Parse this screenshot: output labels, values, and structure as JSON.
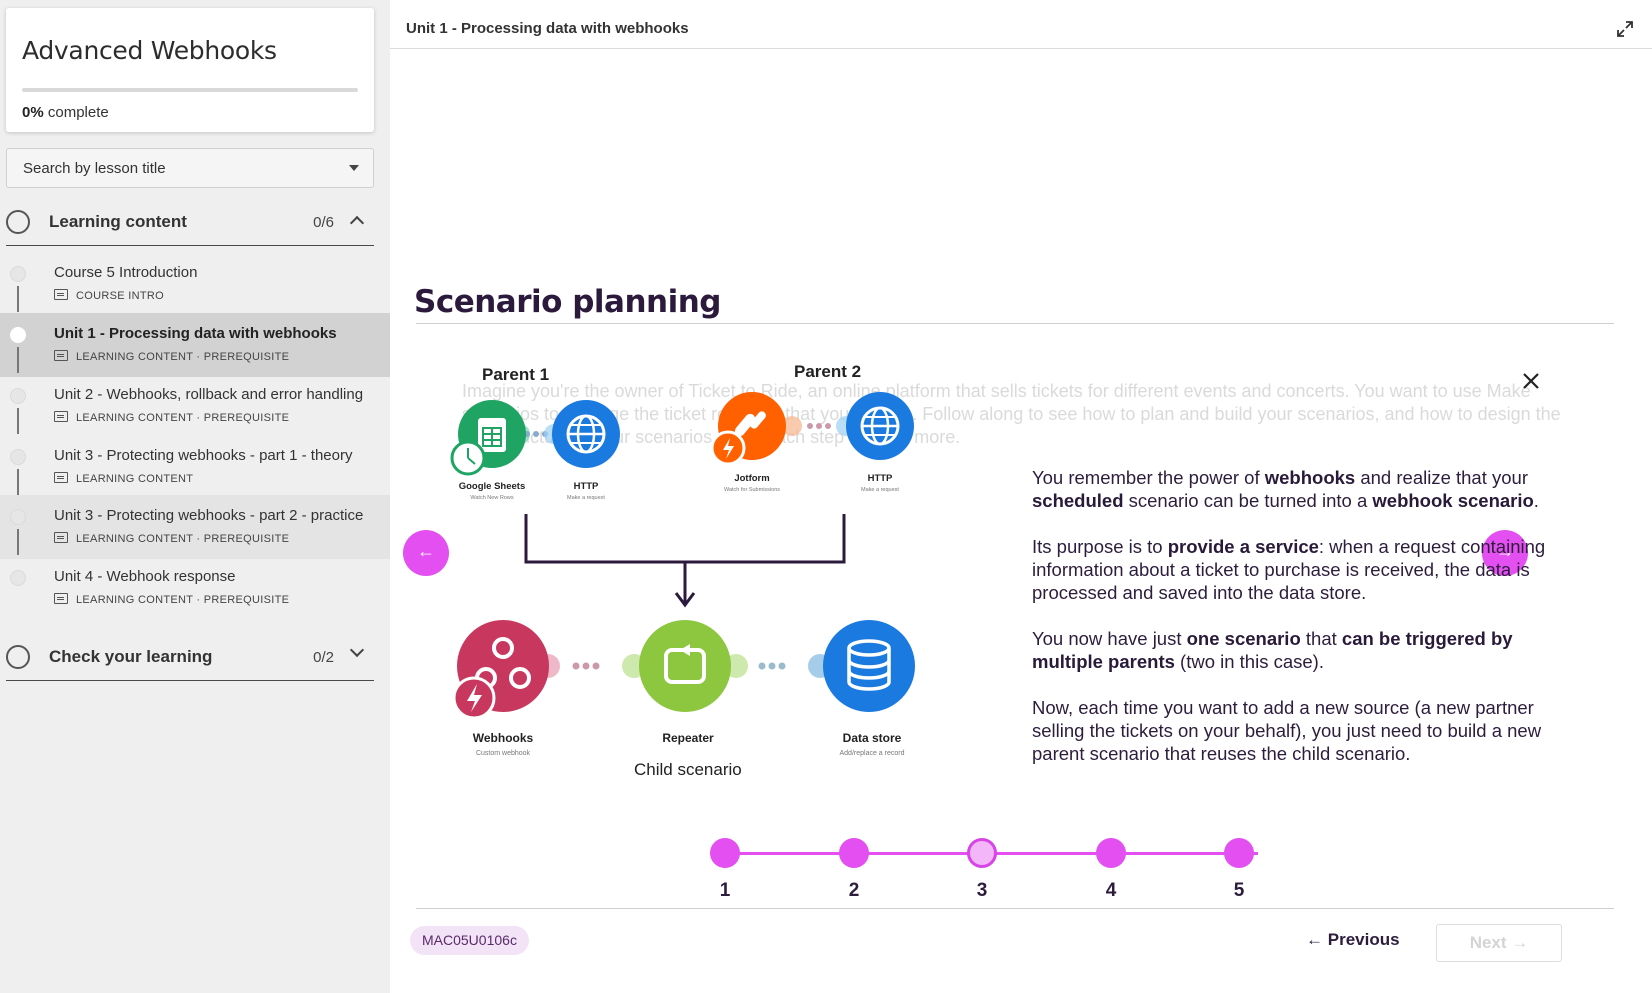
{
  "course": {
    "title": "Advanced Webhooks",
    "progress_percent": 0,
    "progress_value": "0%",
    "progress_suffix": "complete"
  },
  "search": {
    "label": "Search by lesson title"
  },
  "sections": [
    {
      "title": "Learning content",
      "count": "0/6",
      "expanded": true
    },
    {
      "title": "Check your learning",
      "count": "0/2",
      "expanded": false
    }
  ],
  "lessons": [
    {
      "title": "Course 5 Introduction",
      "meta": "COURSE INTRO"
    },
    {
      "title": "Unit 1 - Processing data with webhooks",
      "meta": "LEARNING CONTENT · PREREQUISITE"
    },
    {
      "title": "Unit 2 - Webhooks, rollback and error handling",
      "meta": "LEARNING CONTENT · PREREQUISITE"
    },
    {
      "title": "Unit 3 - Protecting webhooks - part 1 - theory",
      "meta": "LEARNING CONTENT"
    },
    {
      "title": "Unit 3 - Protecting webhooks - part 2 - practice",
      "meta": "LEARNING CONTENT · PREREQUISITE"
    },
    {
      "title": "Unit 4 - Webhook response",
      "meta": "LEARNING CONTENT · PREREQUISITE"
    }
  ],
  "header": {
    "title": "Unit 1 - Processing data with webhooks"
  },
  "slide": {
    "title": "Scenario planning",
    "faded_text": "Imagine you're the owner of Ticket to Ride, an online platform that sells tickets for different events and concerts. You want to use Make scenarios to manage the ticket requests that you receive. Follow along to see how to plan and build your scenarios, and how to design the final structure of your scenarios. Click each step to learn more.",
    "diagram": {
      "parent1": "Parent 1",
      "parent2": "Parent 2",
      "child": "Child scenario",
      "modules": {
        "sheets": {
          "name": "Google Sheets",
          "sub": "Watch New Rows"
        },
        "http1": {
          "name": "HTTP",
          "sub": "Make a request"
        },
        "jotform": {
          "name": "Jotform",
          "sub": "Watch for Submissions"
        },
        "http2": {
          "name": "HTTP",
          "sub": "Make a request"
        },
        "webhooks": {
          "name": "Webhooks",
          "sub": "Custom webhook"
        },
        "repeater": {
          "name": "Repeater",
          "sub": ""
        },
        "datastore": {
          "name": "Data store",
          "sub": "Add/replace a record"
        }
      }
    },
    "steps": [
      "1",
      "2",
      "3",
      "4",
      "5"
    ],
    "current_step": 3
  },
  "footer": {
    "code": "MAC05U0106c",
    "previous": "Previous",
    "next": "Next"
  },
  "colors": {
    "accent": "#e34ff0",
    "title": "#2c1a3d"
  }
}
